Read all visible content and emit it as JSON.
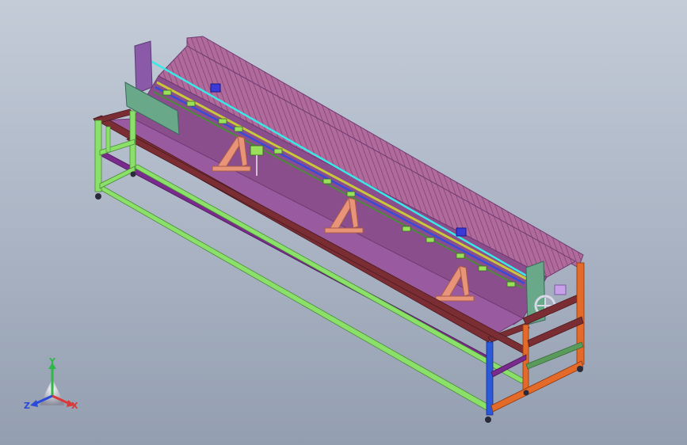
{
  "viewport": {
    "background_top": "#c4ccd8",
    "background_bottom": "#939eb0"
  },
  "model": {
    "colors": {
      "table_top": "#8a4e8c",
      "table_top_edge": "#6e3a72",
      "back_panel": "#b06a9c",
      "back_panel_ribs": "#8b4d7a",
      "frame_dark_red": "#7a2e34",
      "frame_green": "#8be06a",
      "frame_purple": "#7a2a8c",
      "frame_orange": "#e46a2a",
      "frame_blue": "#2a5ad8",
      "rail_blue": "#3a4ad8",
      "rail_yellow": "#c8c83a",
      "laser_cyan": "#3ae8e8",
      "support_salmon": "#e89478",
      "guide_green": "#6aa88a",
      "slider_green": "#9ae05a",
      "handwheel": "#d8d8e8"
    }
  },
  "triad": {
    "axes": [
      {
        "label": "Y",
        "color": "#2fb84a"
      },
      {
        "label": "X",
        "color": "#d83a3a"
      },
      {
        "label": "Z",
        "color": "#2a4ad8"
      }
    ]
  }
}
